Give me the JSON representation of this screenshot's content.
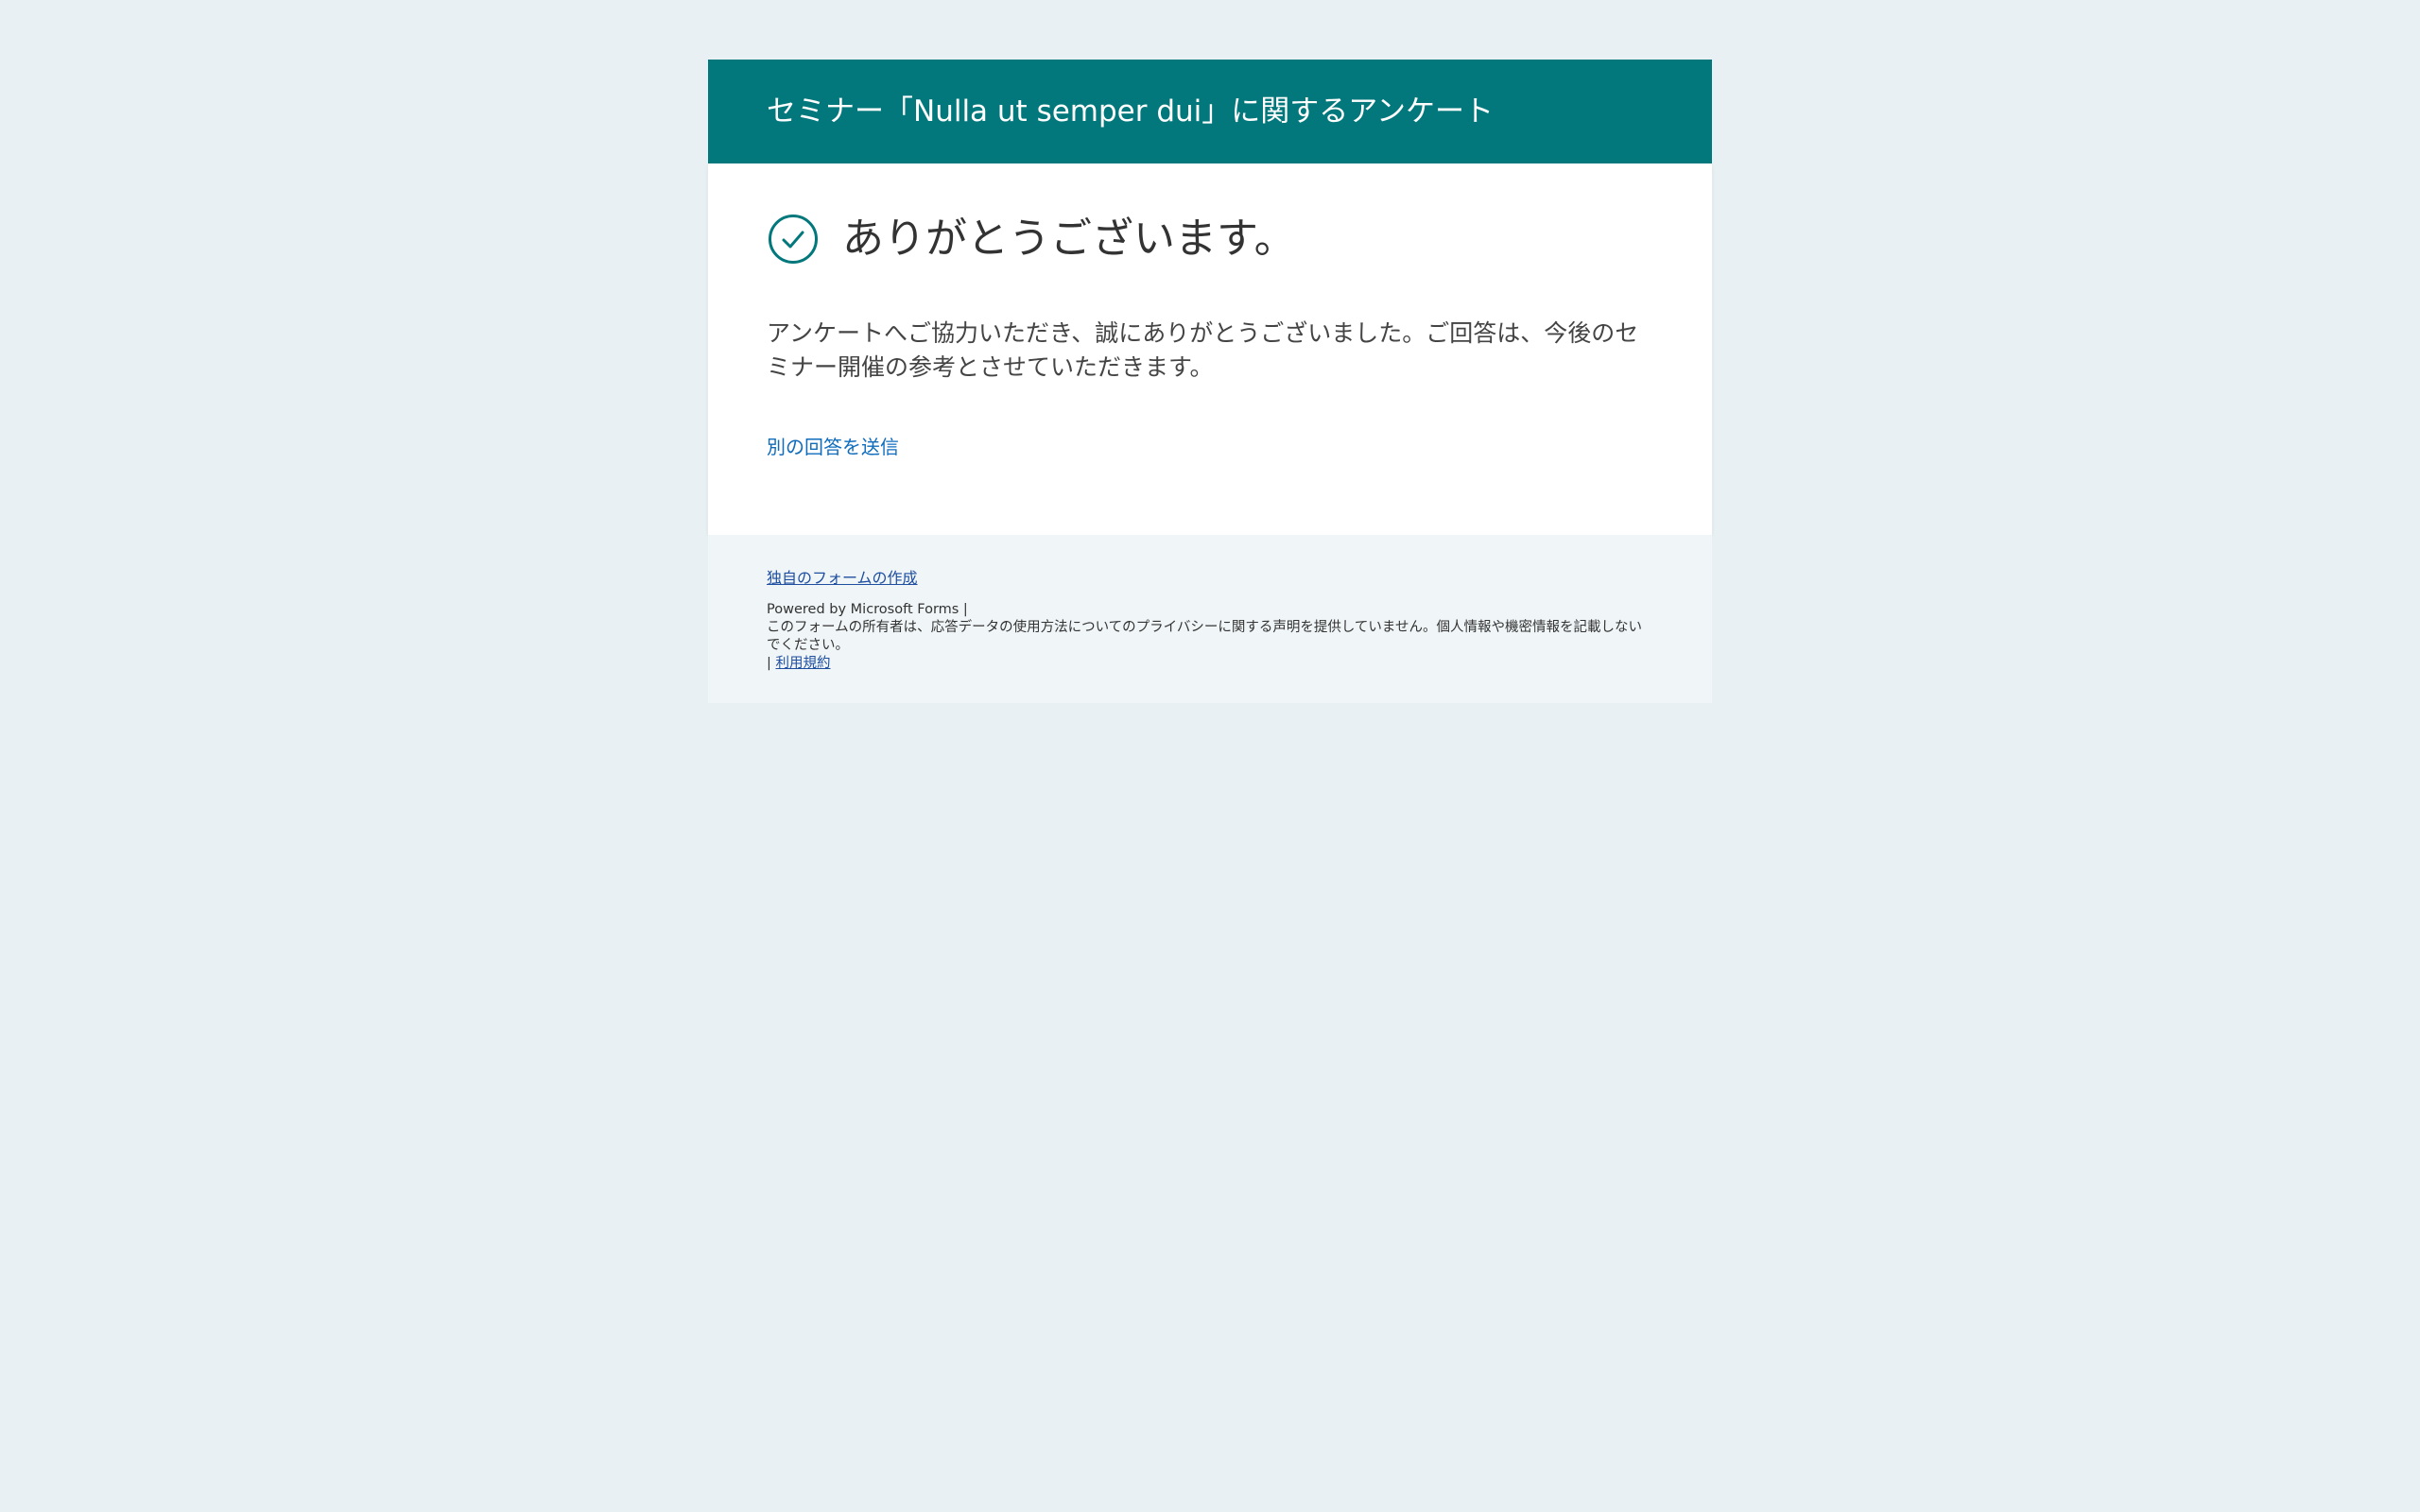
{
  "form": {
    "title": "セミナー「Nulla ut semper dui」に関するアンケート"
  },
  "confirmation": {
    "icon": "check-circle-icon",
    "heading": "ありがとうございます。",
    "message": "アンケートへご協力いただき、誠にありがとうございました。ご回答は、今後のセミナー開催の参考とさせていただきます。",
    "another_response_link": "別の回答を送信"
  },
  "footer": {
    "create_form_link": "独自のフォームの作成",
    "powered_by": "Powered by Microsoft Forms |",
    "privacy_notice": "このフォームの所有者は、応答データの使用方法についてのプライバシーに関する声明を提供していません。個人情報や機密情報を記載しないでください。",
    "separator": "|",
    "terms_link": "利用規約"
  },
  "colors": {
    "header_bg": "#03787c",
    "page_bg": "#e8f0f3",
    "link": "#0f6cbd",
    "icon": "#03787c"
  }
}
